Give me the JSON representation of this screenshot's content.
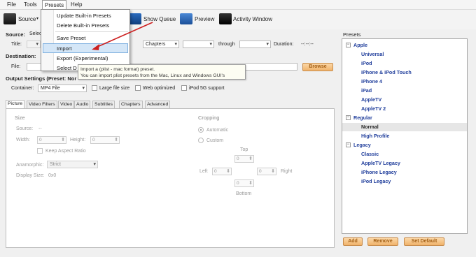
{
  "menubar": {
    "items": [
      "File",
      "Tools",
      "Presets",
      "Help"
    ]
  },
  "toolbar": {
    "source": "Source",
    "show_queue": "Show Queue",
    "preview": "Preview",
    "activity_window": "Activity Window"
  },
  "source_row": {
    "label": "Source:",
    "value_partial": "Selec",
    "title_label": "Title:",
    "chapters_value": "Chapters",
    "through_label": "through",
    "duration_label": "Duration:",
    "duration_value": "--:--:--"
  },
  "destination": {
    "label": "Destination:",
    "file_label": "File:",
    "browse_button": "Browse"
  },
  "output_settings": {
    "label": "Output Settings (Preset: Nor",
    "container_label": "Container:",
    "container_value": "MP4 File",
    "large_file": "Large file size",
    "web_optimized": "Web optimized",
    "ipod_support": "iPod 5G support"
  },
  "tabs": [
    "Picture",
    "Video Filters",
    "Video",
    "Audio",
    "Subtitles",
    "Chapters",
    "Advanced"
  ],
  "picture": {
    "size_heading": "Size",
    "source_label": "Source:",
    "source_value": "--",
    "width_label": "Width:",
    "width_value": "0",
    "height_label": "Height:",
    "height_value": "0",
    "keep_aspect": "Keep Aspect Ratio",
    "anamorphic_label": "Anamorphic:",
    "anamorphic_value": "Strict",
    "display_size_label": "Display Size:",
    "display_size_value": "0x0",
    "cropping_heading": "Cropping",
    "automatic": "Automatic",
    "custom": "Custom",
    "top": "Top",
    "left": "Left",
    "right": "Right",
    "bottom": "Bottom",
    "crop_top": "0",
    "crop_left": "0",
    "crop_right": "0",
    "crop_bottom": "0"
  },
  "presets_menu": {
    "update": "Update Built-in Presets",
    "delete": "Delete Built-in Presets",
    "save": "Save Preset",
    "import": "Import",
    "export": "Export (Experimental)",
    "select_partial": "Select D"
  },
  "tooltip": {
    "line1": "Import a (plist - mac format) preset.",
    "line2": "You can import plist presets from the Mac, Linux and Windows GUI's"
  },
  "presets_panel": {
    "title": "Presets",
    "groups": {
      "apple": "Apple",
      "regular": "Regular",
      "legacy": "Legacy"
    },
    "apple_items": [
      "Universal",
      "iPod",
      "iPhone & iPod Touch",
      "iPhone 4",
      "iPad",
      "AppleTV",
      "AppleTV 2"
    ],
    "regular_items": [
      "Normal",
      "High Profile"
    ],
    "legacy_items": [
      "Classic",
      "AppleTV Legacy",
      "iPhone Legacy",
      "iPod Legacy"
    ],
    "toggle_symbol": "−",
    "selected": "Normal",
    "add_button": "Add",
    "remove_button": "Remove",
    "set_default_button": "Set Default"
  },
  "colors": {
    "preset_link": "#1f3d9b",
    "annotation_arrow": "#cc1f1f",
    "button_orange": "#f0b36b"
  }
}
